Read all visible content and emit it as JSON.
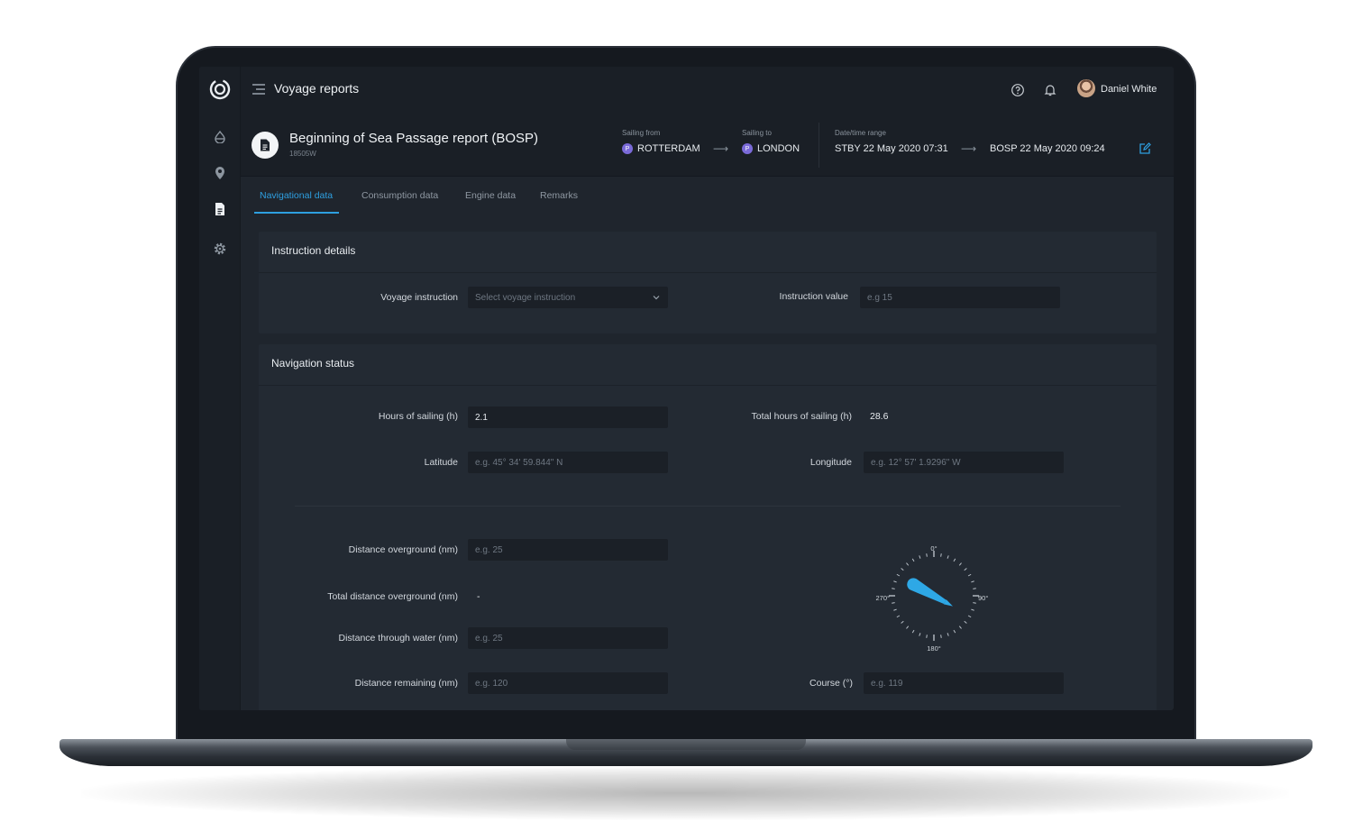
{
  "app": {
    "title": "Voyage reports"
  },
  "user": {
    "name": "Daniel White"
  },
  "report": {
    "title": "Beginning of Sea Passage report (BOSP)",
    "code": "18505W",
    "sailing_from": {
      "label": "Sailing from",
      "port": "ROTTERDAM",
      "badge": "P"
    },
    "sailing_to": {
      "label": "Sailing to",
      "port": "LONDON",
      "badge": "P"
    },
    "date_range": {
      "label": "Date/time range",
      "start": "STBY 22 May 2020 07:31",
      "end": "BOSP 22 May 2020 09:24"
    }
  },
  "tabs": [
    {
      "label": "Navigational data",
      "active": true
    },
    {
      "label": "Consumption data",
      "active": false
    },
    {
      "label": "Engine data",
      "active": false
    },
    {
      "label": "Remarks",
      "active": false
    }
  ],
  "instruction": {
    "title": "Instruction details",
    "voyage_instruction": {
      "label": "Voyage instruction",
      "placeholder": "Select voyage instruction"
    },
    "instruction_value": {
      "label": "Instruction value",
      "placeholder": "e.g 15"
    }
  },
  "navigation": {
    "title": "Navigation status",
    "hours_sailing": {
      "label": "Hours of sailing (h)",
      "value": "2.1"
    },
    "total_hours": {
      "label": "Total hours of sailing (h)",
      "value": "28.6"
    },
    "latitude": {
      "label": "Latitude",
      "placeholder": "e.g. 45° 34' 59.844\" N"
    },
    "longitude": {
      "label": "Longitude",
      "placeholder": "e.g. 12° 57' 1.9296\" W"
    },
    "distance_overground": {
      "label": "Distance overground (nm)",
      "placeholder": "e.g. 25"
    },
    "total_distance_overground": {
      "label": "Total distance overground (nm)",
      "value": "-"
    },
    "distance_through_water": {
      "label": "Distance through water (nm)",
      "placeholder": "e.g. 25"
    },
    "distance_remaining": {
      "label": "Distance remaining (nm)",
      "placeholder": "e.g. 120"
    },
    "course": {
      "label": "Course (°)",
      "placeholder": "e.g. 119"
    },
    "compass": {
      "labels": {
        "n": "0°",
        "e": "90°",
        "s": "180°",
        "w": "270°"
      },
      "heading_deg": 119,
      "color": "#2ea8e6"
    }
  },
  "colors": {
    "accent": "#2e9fe0",
    "port_badge": "#7a6ad8"
  }
}
